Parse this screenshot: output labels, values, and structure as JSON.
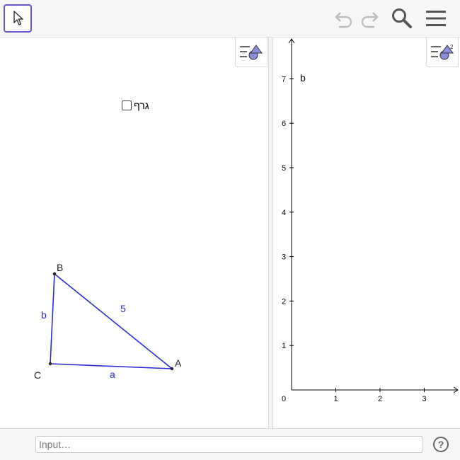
{
  "toolbar": {
    "move_tool": "move-tool",
    "undo": "undo",
    "redo": "redo",
    "search": "search",
    "menu": "menu"
  },
  "view1": {
    "checkbox_label": "גרף",
    "checkbox_checked": false,
    "points": {
      "A": "A",
      "B": "B",
      "C": "C"
    },
    "segments": {
      "a": "a",
      "b": "b",
      "c_value": "5"
    }
  },
  "view2": {
    "label_b": "b",
    "x_ticks": [
      "1",
      "2",
      "3"
    ],
    "y_ticks": [
      "1",
      "2",
      "3",
      "4",
      "5",
      "6",
      "7"
    ],
    "origin_label": "0"
  },
  "input_bar": {
    "placeholder": "Input…",
    "help": "?"
  },
  "colors": {
    "accent": "#6557d2",
    "segment": "#2b2bd6",
    "axis": "#000000"
  }
}
